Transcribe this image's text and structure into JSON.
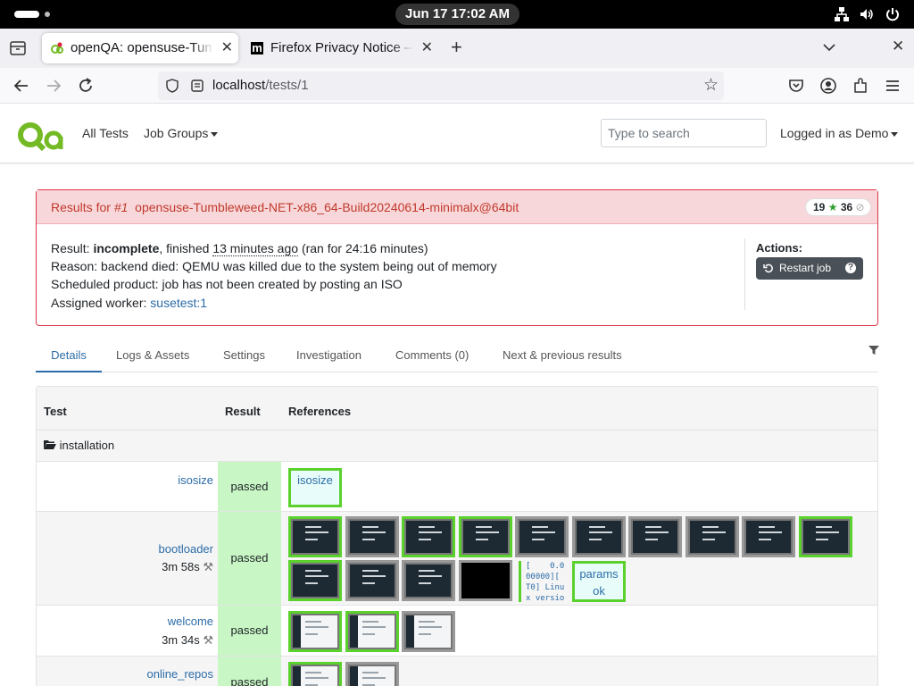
{
  "system": {
    "clock": "Jun 17  17:02 AM"
  },
  "browser": {
    "tabs": [
      {
        "title": "openQA: opensuse-Tumbleweed",
        "active": true
      },
      {
        "title": "Firefox Privacy Notice — Mozilla",
        "active": false
      }
    ],
    "url_host": "localhost",
    "url_path": "/tests/1"
  },
  "app": {
    "nav": {
      "all_tests": "All Tests",
      "job_groups": "Job Groups"
    },
    "search_placeholder": "Type to search",
    "user_menu": "Logged in as Demo"
  },
  "job": {
    "results_for": "Results for",
    "job_id": "#1",
    "job_name": "opensuse-Tumbleweed-NET-x86_64-Build20240614-minimalx@64bit",
    "badge_passed": "19",
    "badge_skipped": "36",
    "result_label": "Result:",
    "result_value": "incomplete",
    "finished_prefix": ", finished",
    "finished_ago": "13 minutes ago",
    "duration": "(ran for 24:16 minutes)",
    "reason": "Reason: backend died: QEMU was killed due to the system being out of memory",
    "scheduled_product": "Scheduled product: job has not been created by posting an ISO",
    "worker_label": "Assigned worker:",
    "worker_value": "susetest:1",
    "actions_label": "Actions:",
    "restart_label": "Restart job"
  },
  "page_tabs": [
    "Details",
    "Logs & Assets",
    "Settings",
    "Investigation",
    "Comments (0)",
    "Next & previous results"
  ],
  "table": {
    "headers": {
      "test": "Test",
      "result": "Result",
      "references": "References"
    },
    "category": "installation",
    "rows": [
      {
        "name": "isosize",
        "duration": "",
        "result": "passed",
        "text_ref": "isosize"
      },
      {
        "name": "bootloader",
        "duration": "3m 58s",
        "result": "passed",
        "log_ref": "[    0.0\n00000][\nT0] Linu\nx versio",
        "text_ref": "params ok"
      },
      {
        "name": "welcome",
        "duration": "3m 34s",
        "result": "passed"
      },
      {
        "name": "online_repos",
        "duration": "",
        "result": "passed"
      }
    ]
  },
  "colors": {
    "accent": "#2c6ca8",
    "failure_border": "#dc3545",
    "failure_header": "#f8d7da",
    "passed_cell": "#c8f7c5",
    "ok_thumb_border": "#5bd12e"
  }
}
